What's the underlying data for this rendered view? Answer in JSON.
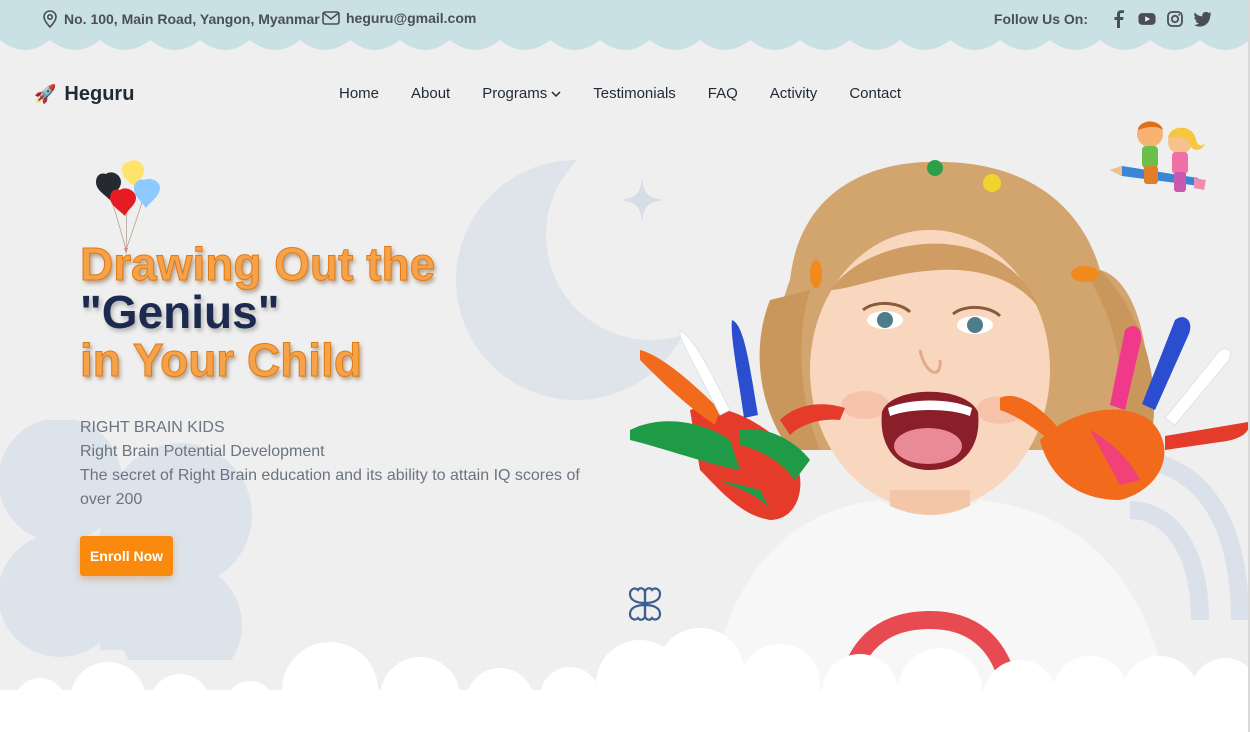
{
  "topbar": {
    "address": "No. 100, Main Road, Yangon, Myanmar",
    "email": "heguru@gmail.com",
    "follow_label": "Follow Us On:",
    "socials": [
      "facebook-icon",
      "youtube-icon",
      "instagram-icon",
      "twitter-icon"
    ]
  },
  "brand": {
    "name": "Heguru",
    "icon": "rocket-icon"
  },
  "nav": {
    "home": "Home",
    "about": "About",
    "programs": "Programs",
    "testimonials": "Testimonials",
    "faq": "FAQ",
    "activity": "Activity",
    "contact": "Contact"
  },
  "hero": {
    "title_line1": "Drawing Out the",
    "title_line2": "\"Genius\"",
    "title_line3": "in Your Child",
    "subtitle1": "RIGHT BRAIN KIDS",
    "subtitle2": "Right Brain Potential Development",
    "subtitle3": "The secret of Right Brain education and its ability to attain IQ scores of over 200",
    "cta": "Enroll Now"
  },
  "colors": {
    "accent": "#f98a0d",
    "title_orange": "#f6a24a",
    "title_navy": "#1b2a4e",
    "topbar": "#c9e0e5"
  }
}
